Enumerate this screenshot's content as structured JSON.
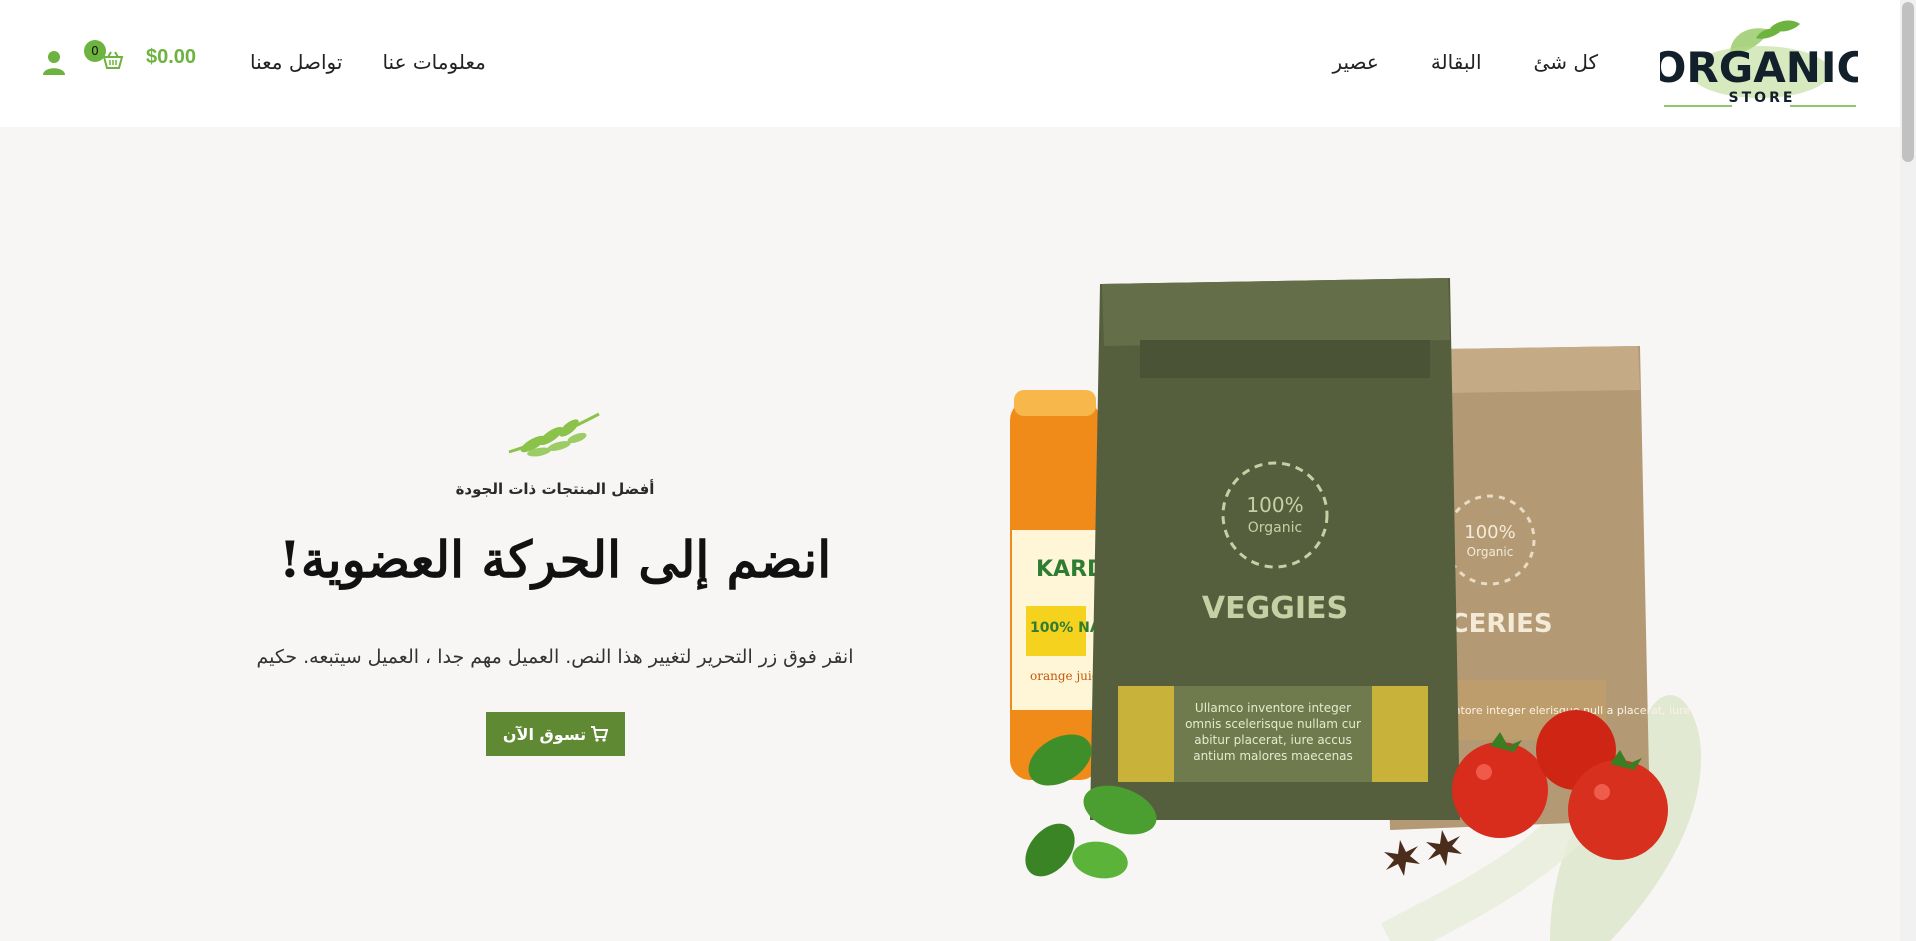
{
  "logo": {
    "line1": "ORGANIC",
    "line2": "STORE"
  },
  "nav": {
    "items": [
      "كل شئ",
      "البقالة",
      "عصير"
    ],
    "secondary": [
      "معلومات عنا",
      "تواصل معنا"
    ]
  },
  "cart": {
    "count": "0",
    "amount": "$0.00"
  },
  "hero": {
    "tagline": "أفضل المنتجات ذات الجودة",
    "headline": "انضم إلى الحركة العضوية!",
    "subtext": "انقر فوق زر التحرير لتغيير هذا النص. العميل مهم جدا ، العميل سيتبعه. حكيم",
    "cta_label": "تسوق الآن"
  },
  "products": {
    "bag1": {
      "badge_pct": "100%",
      "badge_word": "Organic",
      "name": "VEGGIES",
      "note": "Ullamco inventore integer omnis scelerisque nullam cur abitur placerat, iure accus antium malores maecenas"
    },
    "bag2": {
      "badge_pct": "100%",
      "badge_word": "Organic",
      "name": "OCERIES",
      "note": "o inventore integer elerisque null a placerat, iure"
    },
    "jar": {
      "brand": "KARD",
      "label": "100% NATURAL",
      "flavor": "orange juice"
    }
  },
  "colors": {
    "accent": "#6cb33f",
    "button": "#5f8a33",
    "bag_green": "#555f3e",
    "bag_kraft": "#b39a74",
    "hero_bg": "#f8f6f4"
  },
  "icons": [
    "cart-icon",
    "user-icon",
    "sprig-icon"
  ]
}
